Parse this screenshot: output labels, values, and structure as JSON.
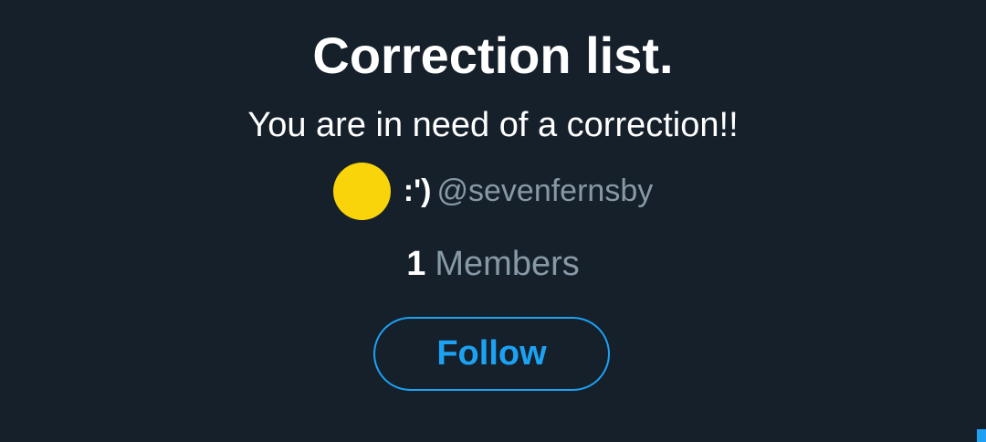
{
  "list": {
    "title": "Correction list.",
    "description": "You are in need of a correction!!",
    "owner": {
      "avatar_color": "#f9d40a",
      "display_name": ":')",
      "handle": "@sevenfernsby"
    },
    "members": {
      "count": "1",
      "label": "Members"
    },
    "follow_label": "Follow"
  },
  "colors": {
    "background": "#15202b",
    "accent": "#1da1f2",
    "secondary_text": "#8899a6"
  }
}
